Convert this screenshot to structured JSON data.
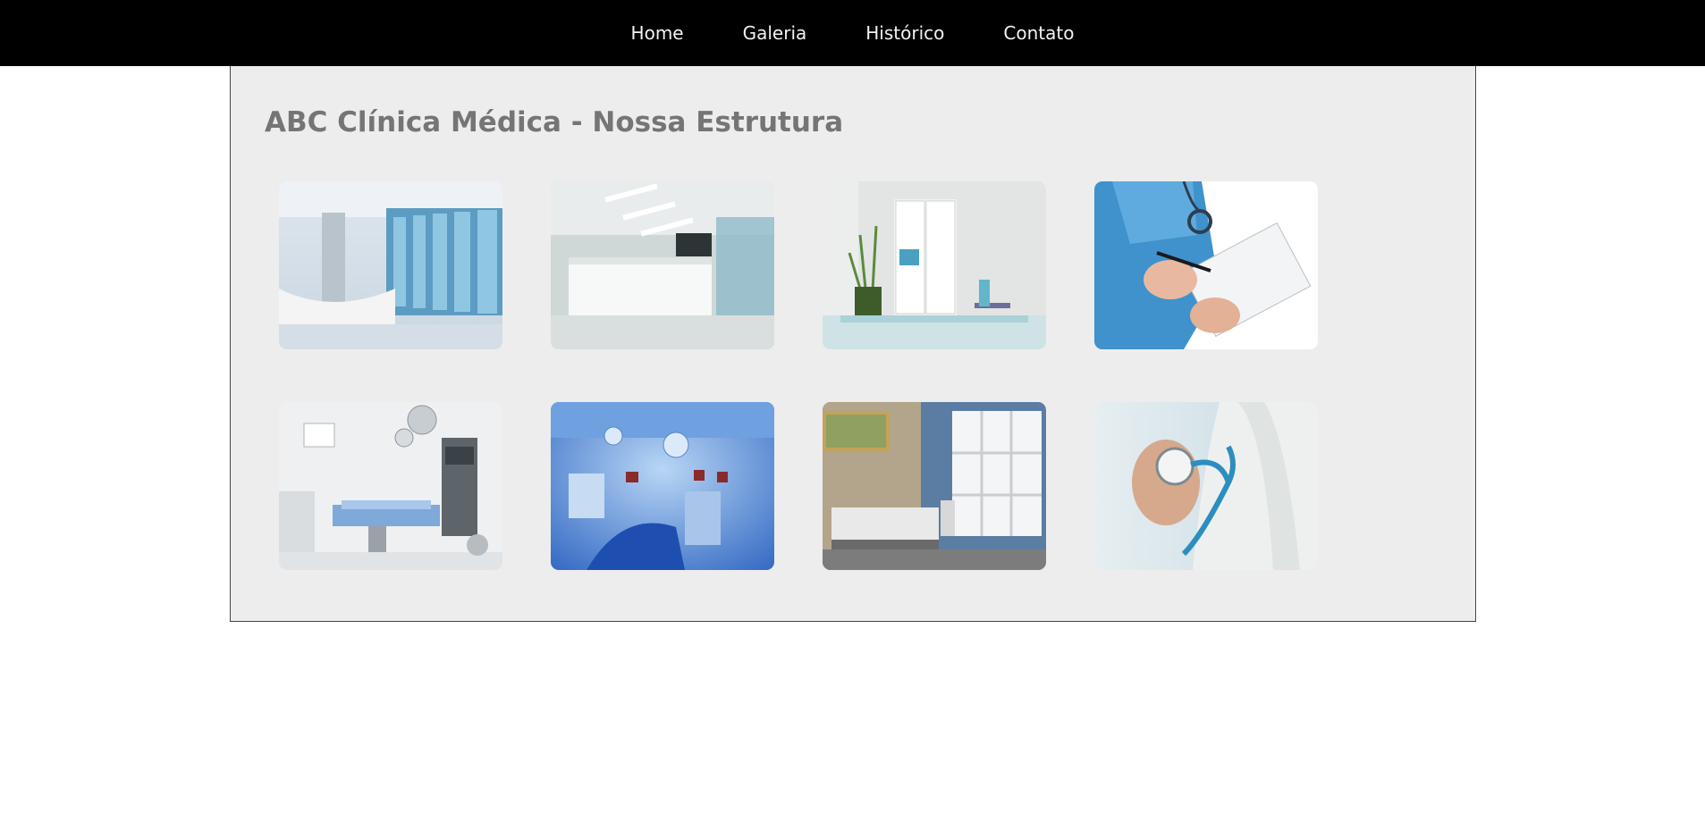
{
  "nav": {
    "items": [
      {
        "label": "Home"
      },
      {
        "label": "Galeria"
      },
      {
        "label": "Histórico"
      },
      {
        "label": "Contato"
      }
    ]
  },
  "main": {
    "title": "ABC Clínica Médica - Nossa Estrutura"
  },
  "gallery": {
    "images": [
      {
        "name": "reception-curved-desk-photo"
      },
      {
        "name": "reception-white-desk-photo"
      },
      {
        "name": "waiting-room-plants-photo"
      },
      {
        "name": "nurse-clipboard-photo"
      },
      {
        "name": "operating-room-photo"
      },
      {
        "name": "surgery-room-blue-photo"
      },
      {
        "name": "exam-room-photo"
      },
      {
        "name": "doctor-stethoscope-photo"
      }
    ]
  },
  "colors": {
    "nav_bg": "#000000",
    "nav_text": "#f2f2f2",
    "panel_bg": "#ededed",
    "title": "#757575"
  }
}
